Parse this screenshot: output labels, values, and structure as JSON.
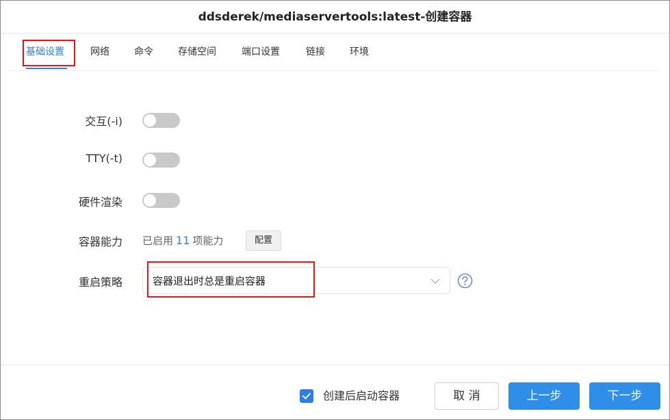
{
  "dialog": {
    "title": "ddsderek/mediaservertools:latest-创建容器"
  },
  "tabs": [
    {
      "label": "基础设置",
      "active": true
    },
    {
      "label": "网络"
    },
    {
      "label": "命令"
    },
    {
      "label": "存储空间"
    },
    {
      "label": "端口设置"
    },
    {
      "label": "链接"
    },
    {
      "label": "环境"
    }
  ],
  "form": {
    "interactive": {
      "label": "交互(-i)",
      "enabled": false
    },
    "tty": {
      "label": "TTY(-t)",
      "enabled": false
    },
    "hardware_render": {
      "label": "硬件渲染",
      "enabled": false
    },
    "capabilities": {
      "label": "容器能力",
      "prefix": "已启用",
      "count": "11",
      "suffix": "项能力",
      "config_label": "配置"
    },
    "restart_policy": {
      "label": "重启策略",
      "value": "容器退出时总是重启容器"
    }
  },
  "footer": {
    "auto_start_label": "创建后启动容器",
    "auto_start_checked": true,
    "cancel_label": "取 消",
    "prev_label": "上一步",
    "next_label": "下一步"
  },
  "colors": {
    "accent": "#2f7fe0",
    "primary_button": "#2f8ee8",
    "highlight_box": "#e0151b",
    "toggle_off": "#c9c9c9"
  }
}
